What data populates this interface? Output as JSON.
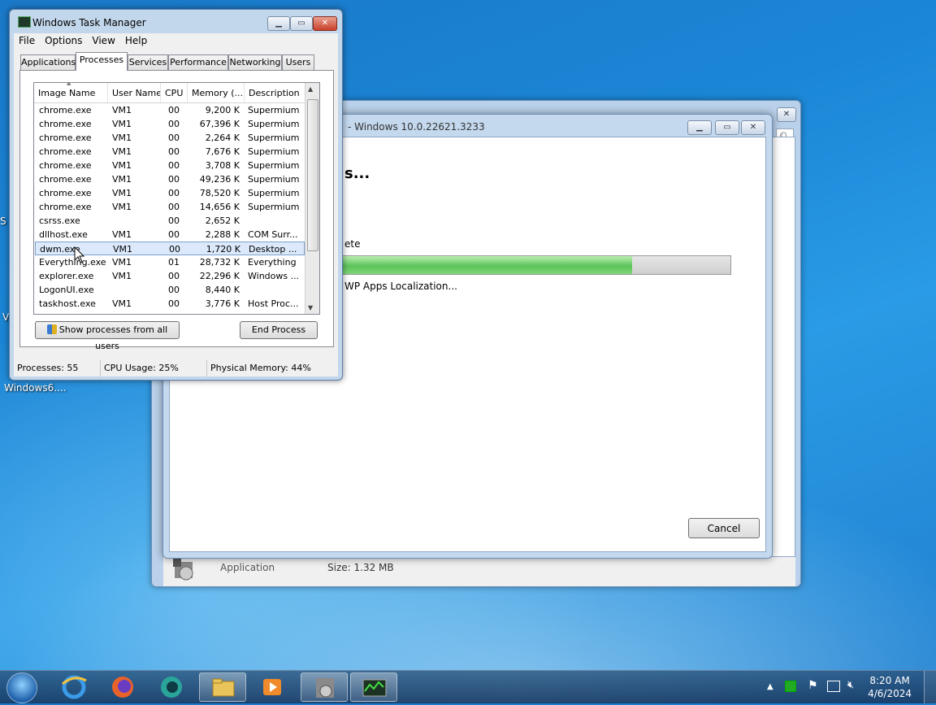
{
  "desktop": {
    "icon_label": "Windows6....",
    "partial_labels": [
      "S",
      "V"
    ]
  },
  "installer_window": {
    "title": "- Windows 10.0.22621.3233",
    "heading": "s...",
    "status_fragment": "ete",
    "progress_fraction": 0.75,
    "progress_text": "WP Apps Localization...",
    "cancel_label": "Cancel",
    "file_type": "Application",
    "file_size": "Size: 1.32 MB"
  },
  "task_manager": {
    "title": "Windows Task Manager",
    "menu": [
      "File",
      "Options",
      "View",
      "Help"
    ],
    "tabs": [
      "Applications",
      "Processes",
      "Services",
      "Performance",
      "Networking",
      "Users"
    ],
    "active_tab": "Processes",
    "columns": [
      "Image Name",
      "User Name",
      "CPU",
      "Memory (...",
      "Description"
    ],
    "rows": [
      {
        "name": "chrome.exe",
        "user": "VM1",
        "cpu": "00",
        "mem": "9,200 K",
        "desc": "Supermium"
      },
      {
        "name": "chrome.exe",
        "user": "VM1",
        "cpu": "00",
        "mem": "67,396 K",
        "desc": "Supermium"
      },
      {
        "name": "chrome.exe",
        "user": "VM1",
        "cpu": "00",
        "mem": "2,264 K",
        "desc": "Supermium"
      },
      {
        "name": "chrome.exe",
        "user": "VM1",
        "cpu": "00",
        "mem": "7,676 K",
        "desc": "Supermium"
      },
      {
        "name": "chrome.exe",
        "user": "VM1",
        "cpu": "00",
        "mem": "3,708 K",
        "desc": "Supermium"
      },
      {
        "name": "chrome.exe",
        "user": "VM1",
        "cpu": "00",
        "mem": "49,236 K",
        "desc": "Supermium"
      },
      {
        "name": "chrome.exe",
        "user": "VM1",
        "cpu": "00",
        "mem": "78,520 K",
        "desc": "Supermium"
      },
      {
        "name": "chrome.exe",
        "user": "VM1",
        "cpu": "00",
        "mem": "14,656 K",
        "desc": "Supermium"
      },
      {
        "name": "csrss.exe",
        "user": "",
        "cpu": "00",
        "mem": "2,652 K",
        "desc": ""
      },
      {
        "name": "dllhost.exe",
        "user": "VM1",
        "cpu": "00",
        "mem": "2,288 K",
        "desc": "COM Surr..."
      },
      {
        "name": "dwm.exe",
        "user": "VM1",
        "cpu": "00",
        "mem": "1,720 K",
        "desc": "Desktop ...",
        "selected": true
      },
      {
        "name": "Everything.exe",
        "user": "VM1",
        "cpu": "01",
        "mem": "28,732 K",
        "desc": "Everything"
      },
      {
        "name": "explorer.exe",
        "user": "VM1",
        "cpu": "00",
        "mem": "22,296 K",
        "desc": "Windows ..."
      },
      {
        "name": "LogonUI.exe",
        "user": "",
        "cpu": "00",
        "mem": "8,440 K",
        "desc": ""
      },
      {
        "name": "taskhost.exe",
        "user": "VM1",
        "cpu": "00",
        "mem": "3,776 K",
        "desc": "Host Proc..."
      }
    ],
    "show_all_label": "Show processes from all users",
    "end_process_label": "End Process",
    "status": {
      "processes": "Processes: 55",
      "cpu": "CPU Usage: 25%",
      "memory": "Physical Memory: 44%"
    }
  },
  "taskbar": {
    "time": "8:20 AM",
    "date": "4/6/2024",
    "pinned_icons": [
      "start-orb-icon",
      "internet-explorer-icon",
      "firefox-icon",
      "teal-app-icon",
      "file-explorer-icon",
      "media-player-icon",
      "installer-icon",
      "task-manager-icon"
    ]
  },
  "colors": {
    "progress_green": "#5dc35a",
    "selection": "#dbe9fb",
    "desktop_blue": "#1b86d6"
  }
}
